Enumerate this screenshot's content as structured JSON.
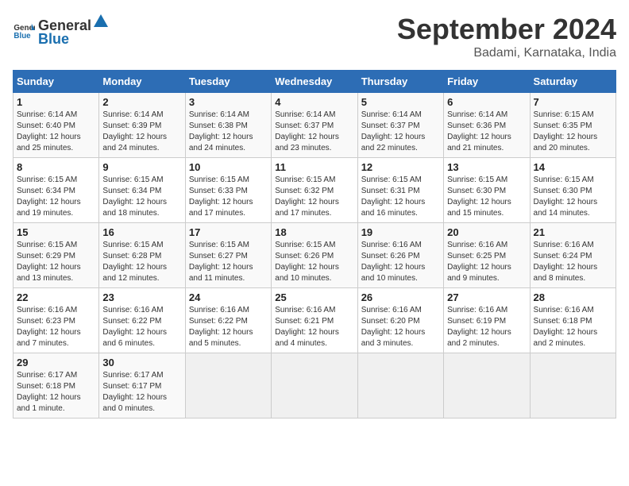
{
  "header": {
    "logo_general": "General",
    "logo_blue": "Blue",
    "month": "September 2024",
    "location": "Badami, Karnataka, India"
  },
  "weekdays": [
    "Sunday",
    "Monday",
    "Tuesday",
    "Wednesday",
    "Thursday",
    "Friday",
    "Saturday"
  ],
  "weeks": [
    [
      {
        "day": "1",
        "detail": "Sunrise: 6:14 AM\nSunset: 6:40 PM\nDaylight: 12 hours\nand 25 minutes."
      },
      {
        "day": "2",
        "detail": "Sunrise: 6:14 AM\nSunset: 6:39 PM\nDaylight: 12 hours\nand 24 minutes."
      },
      {
        "day": "3",
        "detail": "Sunrise: 6:14 AM\nSunset: 6:38 PM\nDaylight: 12 hours\nand 24 minutes."
      },
      {
        "day": "4",
        "detail": "Sunrise: 6:14 AM\nSunset: 6:37 PM\nDaylight: 12 hours\nand 23 minutes."
      },
      {
        "day": "5",
        "detail": "Sunrise: 6:14 AM\nSunset: 6:37 PM\nDaylight: 12 hours\nand 22 minutes."
      },
      {
        "day": "6",
        "detail": "Sunrise: 6:14 AM\nSunset: 6:36 PM\nDaylight: 12 hours\nand 21 minutes."
      },
      {
        "day": "7",
        "detail": "Sunrise: 6:15 AM\nSunset: 6:35 PM\nDaylight: 12 hours\nand 20 minutes."
      }
    ],
    [
      {
        "day": "8",
        "detail": "Sunrise: 6:15 AM\nSunset: 6:34 PM\nDaylight: 12 hours\nand 19 minutes."
      },
      {
        "day": "9",
        "detail": "Sunrise: 6:15 AM\nSunset: 6:34 PM\nDaylight: 12 hours\nand 18 minutes."
      },
      {
        "day": "10",
        "detail": "Sunrise: 6:15 AM\nSunset: 6:33 PM\nDaylight: 12 hours\nand 17 minutes."
      },
      {
        "day": "11",
        "detail": "Sunrise: 6:15 AM\nSunset: 6:32 PM\nDaylight: 12 hours\nand 17 minutes."
      },
      {
        "day": "12",
        "detail": "Sunrise: 6:15 AM\nSunset: 6:31 PM\nDaylight: 12 hours\nand 16 minutes."
      },
      {
        "day": "13",
        "detail": "Sunrise: 6:15 AM\nSunset: 6:30 PM\nDaylight: 12 hours\nand 15 minutes."
      },
      {
        "day": "14",
        "detail": "Sunrise: 6:15 AM\nSunset: 6:30 PM\nDaylight: 12 hours\nand 14 minutes."
      }
    ],
    [
      {
        "day": "15",
        "detail": "Sunrise: 6:15 AM\nSunset: 6:29 PM\nDaylight: 12 hours\nand 13 minutes."
      },
      {
        "day": "16",
        "detail": "Sunrise: 6:15 AM\nSunset: 6:28 PM\nDaylight: 12 hours\nand 12 minutes."
      },
      {
        "day": "17",
        "detail": "Sunrise: 6:15 AM\nSunset: 6:27 PM\nDaylight: 12 hours\nand 11 minutes."
      },
      {
        "day": "18",
        "detail": "Sunrise: 6:15 AM\nSunset: 6:26 PM\nDaylight: 12 hours\nand 10 minutes."
      },
      {
        "day": "19",
        "detail": "Sunrise: 6:16 AM\nSunset: 6:26 PM\nDaylight: 12 hours\nand 10 minutes."
      },
      {
        "day": "20",
        "detail": "Sunrise: 6:16 AM\nSunset: 6:25 PM\nDaylight: 12 hours\nand 9 minutes."
      },
      {
        "day": "21",
        "detail": "Sunrise: 6:16 AM\nSunset: 6:24 PM\nDaylight: 12 hours\nand 8 minutes."
      }
    ],
    [
      {
        "day": "22",
        "detail": "Sunrise: 6:16 AM\nSunset: 6:23 PM\nDaylight: 12 hours\nand 7 minutes."
      },
      {
        "day": "23",
        "detail": "Sunrise: 6:16 AM\nSunset: 6:22 PM\nDaylight: 12 hours\nand 6 minutes."
      },
      {
        "day": "24",
        "detail": "Sunrise: 6:16 AM\nSunset: 6:22 PM\nDaylight: 12 hours\nand 5 minutes."
      },
      {
        "day": "25",
        "detail": "Sunrise: 6:16 AM\nSunset: 6:21 PM\nDaylight: 12 hours\nand 4 minutes."
      },
      {
        "day": "26",
        "detail": "Sunrise: 6:16 AM\nSunset: 6:20 PM\nDaylight: 12 hours\nand 3 minutes."
      },
      {
        "day": "27",
        "detail": "Sunrise: 6:16 AM\nSunset: 6:19 PM\nDaylight: 12 hours\nand 2 minutes."
      },
      {
        "day": "28",
        "detail": "Sunrise: 6:16 AM\nSunset: 6:18 PM\nDaylight: 12 hours\nand 2 minutes."
      }
    ],
    [
      {
        "day": "29",
        "detail": "Sunrise: 6:17 AM\nSunset: 6:18 PM\nDaylight: 12 hours\nand 1 minute."
      },
      {
        "day": "30",
        "detail": "Sunrise: 6:17 AM\nSunset: 6:17 PM\nDaylight: 12 hours\nand 0 minutes."
      },
      {
        "day": "",
        "detail": ""
      },
      {
        "day": "",
        "detail": ""
      },
      {
        "day": "",
        "detail": ""
      },
      {
        "day": "",
        "detail": ""
      },
      {
        "day": "",
        "detail": ""
      }
    ]
  ]
}
